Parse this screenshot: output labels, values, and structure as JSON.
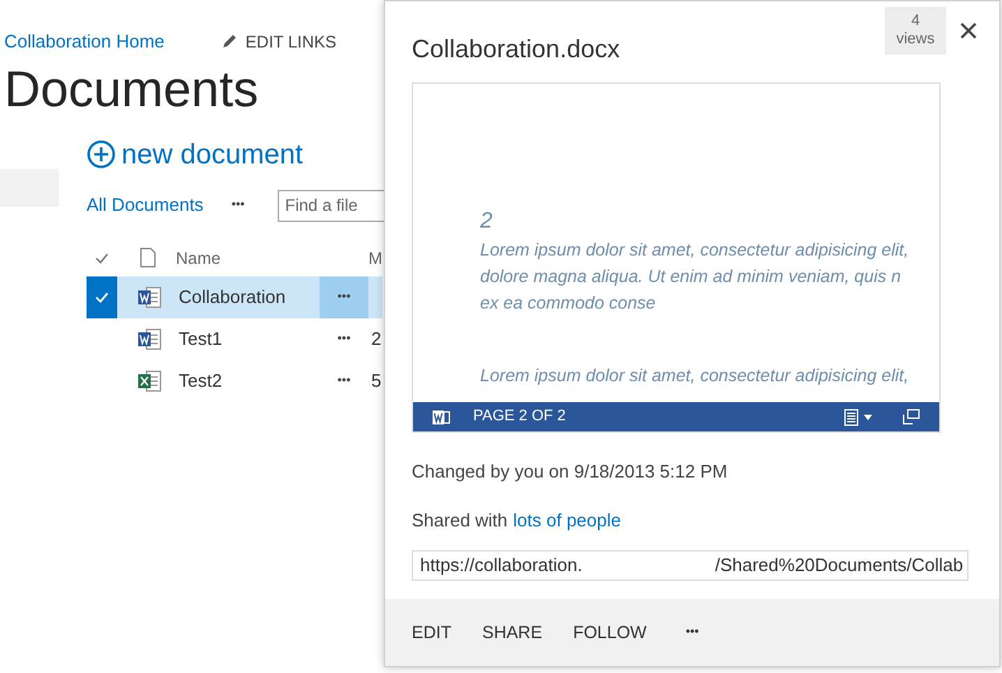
{
  "nav": {
    "home_link": "Collaboration Home",
    "edit_links": "EDIT LINKS"
  },
  "page_title": "Documents",
  "new_document": "new document",
  "view": {
    "label": "All Documents",
    "more": "•••",
    "search": {
      "placeholder": "Find a file"
    }
  },
  "table": {
    "columns": [
      "Name",
      "M"
    ],
    "rows": [
      {
        "name": "Collaboration",
        "kind": "word",
        "selected": true
      },
      {
        "name": "Test1",
        "kind": "word",
        "selected": false,
        "column_2": "2"
      },
      {
        "name": "Test2",
        "kind": "excel",
        "selected": false,
        "column_2": "5"
      }
    ]
  },
  "callout": {
    "title": "Collaboration.docx",
    "views_count": "4",
    "views_label": "views",
    "preview": {
      "page_number": "2",
      "lines": [
        "Lorem ipsum dolor sit amet, consectetur adipisicing elit,",
        "dolore magna aliqua. Ut enim ad minim veniam, quis n",
        "ex ea commodo conse"
      ],
      "second_paragraph": "Lorem ipsum dolor sit amet, consectetur adipisicing elit,",
      "page_indicator": "PAGE 2 OF 2"
    },
    "changed": "Changed by you on 9/18/2013 5:12 PM",
    "shared_prefix": "Shared with",
    "shared_link": "lots of people",
    "url_parts": [
      "https://collaboration.",
      "/Shared%20Documents/Collab"
    ],
    "actions": [
      "EDIT",
      "SHARE",
      "FOLLOW",
      "•••"
    ]
  }
}
